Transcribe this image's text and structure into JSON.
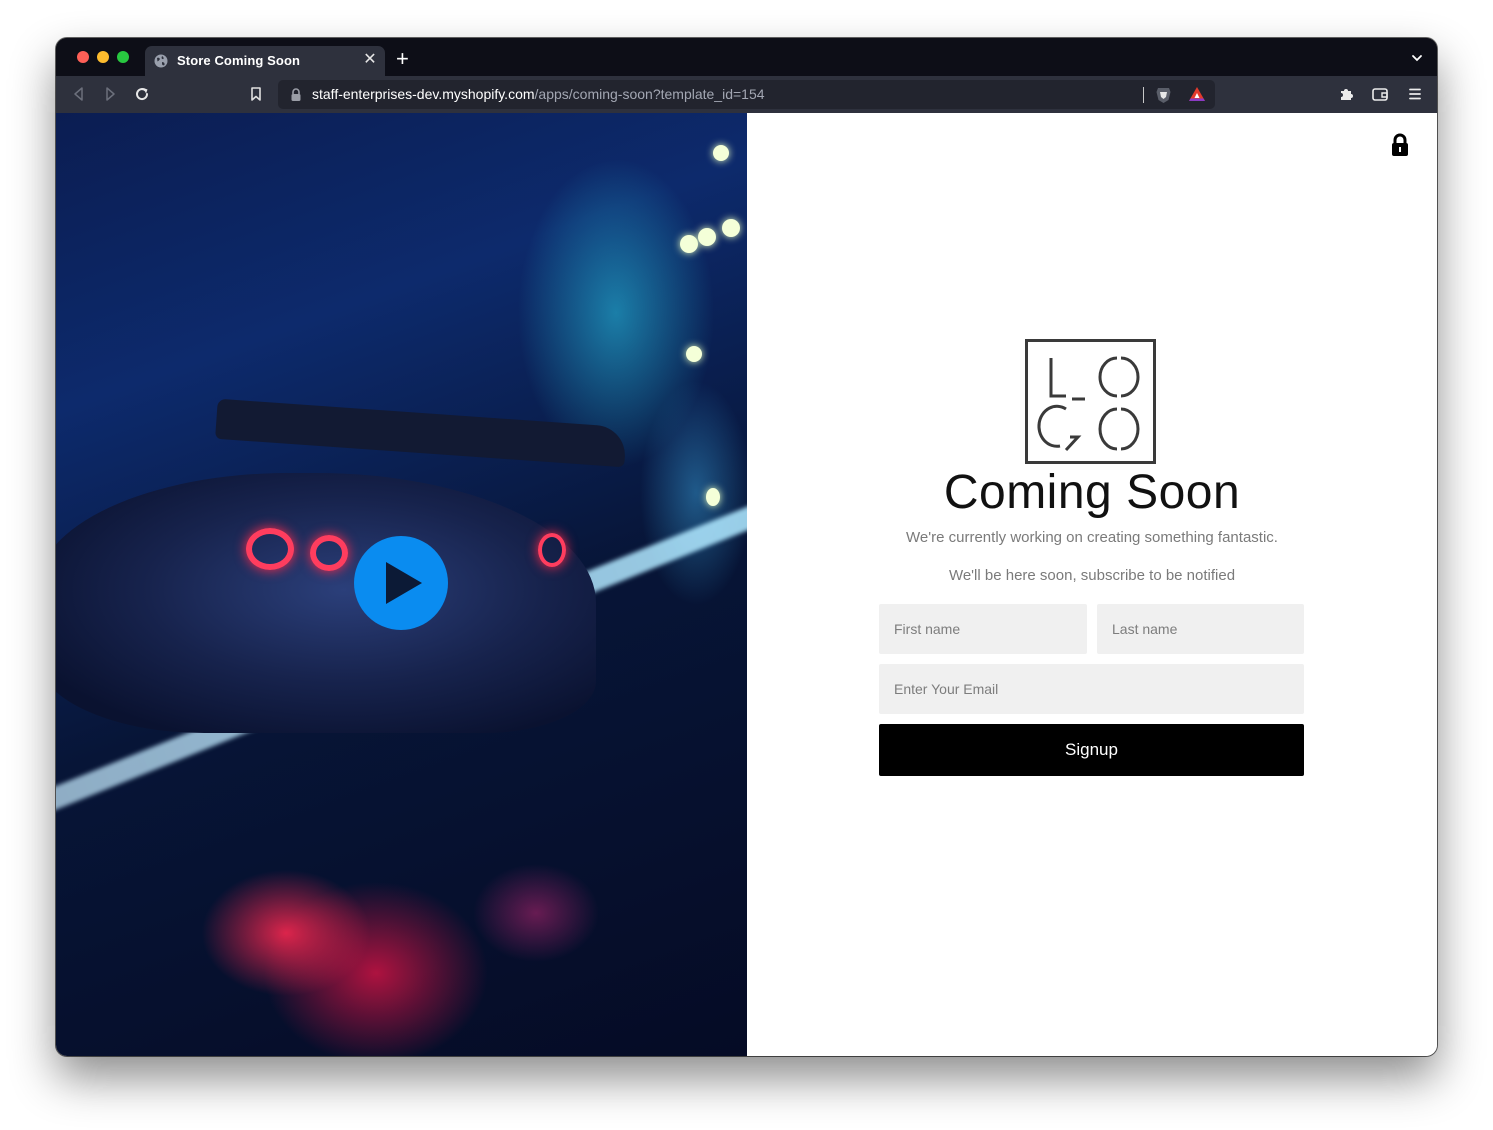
{
  "browser": {
    "tab": {
      "title": "Store Coming Soon",
      "favicon": "globe-icon",
      "close_glyph": "✕"
    },
    "new_tab_glyph": "+",
    "url": {
      "host": "staff-enterprises-dev.myshopify.com",
      "path": "/apps/coming-soon?template_id=154"
    },
    "toolbar_icons": [
      "back-icon",
      "forward-icon",
      "reload-icon",
      "bookmark-icon",
      "lock-icon",
      "brave-shield-icon",
      "brave-rewards-icon",
      "extensions-icon",
      "wallet-icon",
      "menu-icon",
      "tab-list-chevron-icon"
    ]
  },
  "page": {
    "hero": {
      "media": "video-thumbnail",
      "play_icon": "play-icon",
      "play_color": "#0a8cf0"
    },
    "lock_icon": "padlock-icon",
    "logo": {
      "top_row": "LO",
      "bottom_row": "GO"
    },
    "heading": "Coming Soon",
    "subtitle_1": "We're currently working on creating something fantastic.",
    "subtitle_2": "We'll be here soon, subscribe to be notified",
    "form": {
      "first_name_placeholder": "First name",
      "last_name_placeholder": "Last name",
      "email_placeholder": "Enter Your Email",
      "submit_label": "Signup"
    }
  }
}
